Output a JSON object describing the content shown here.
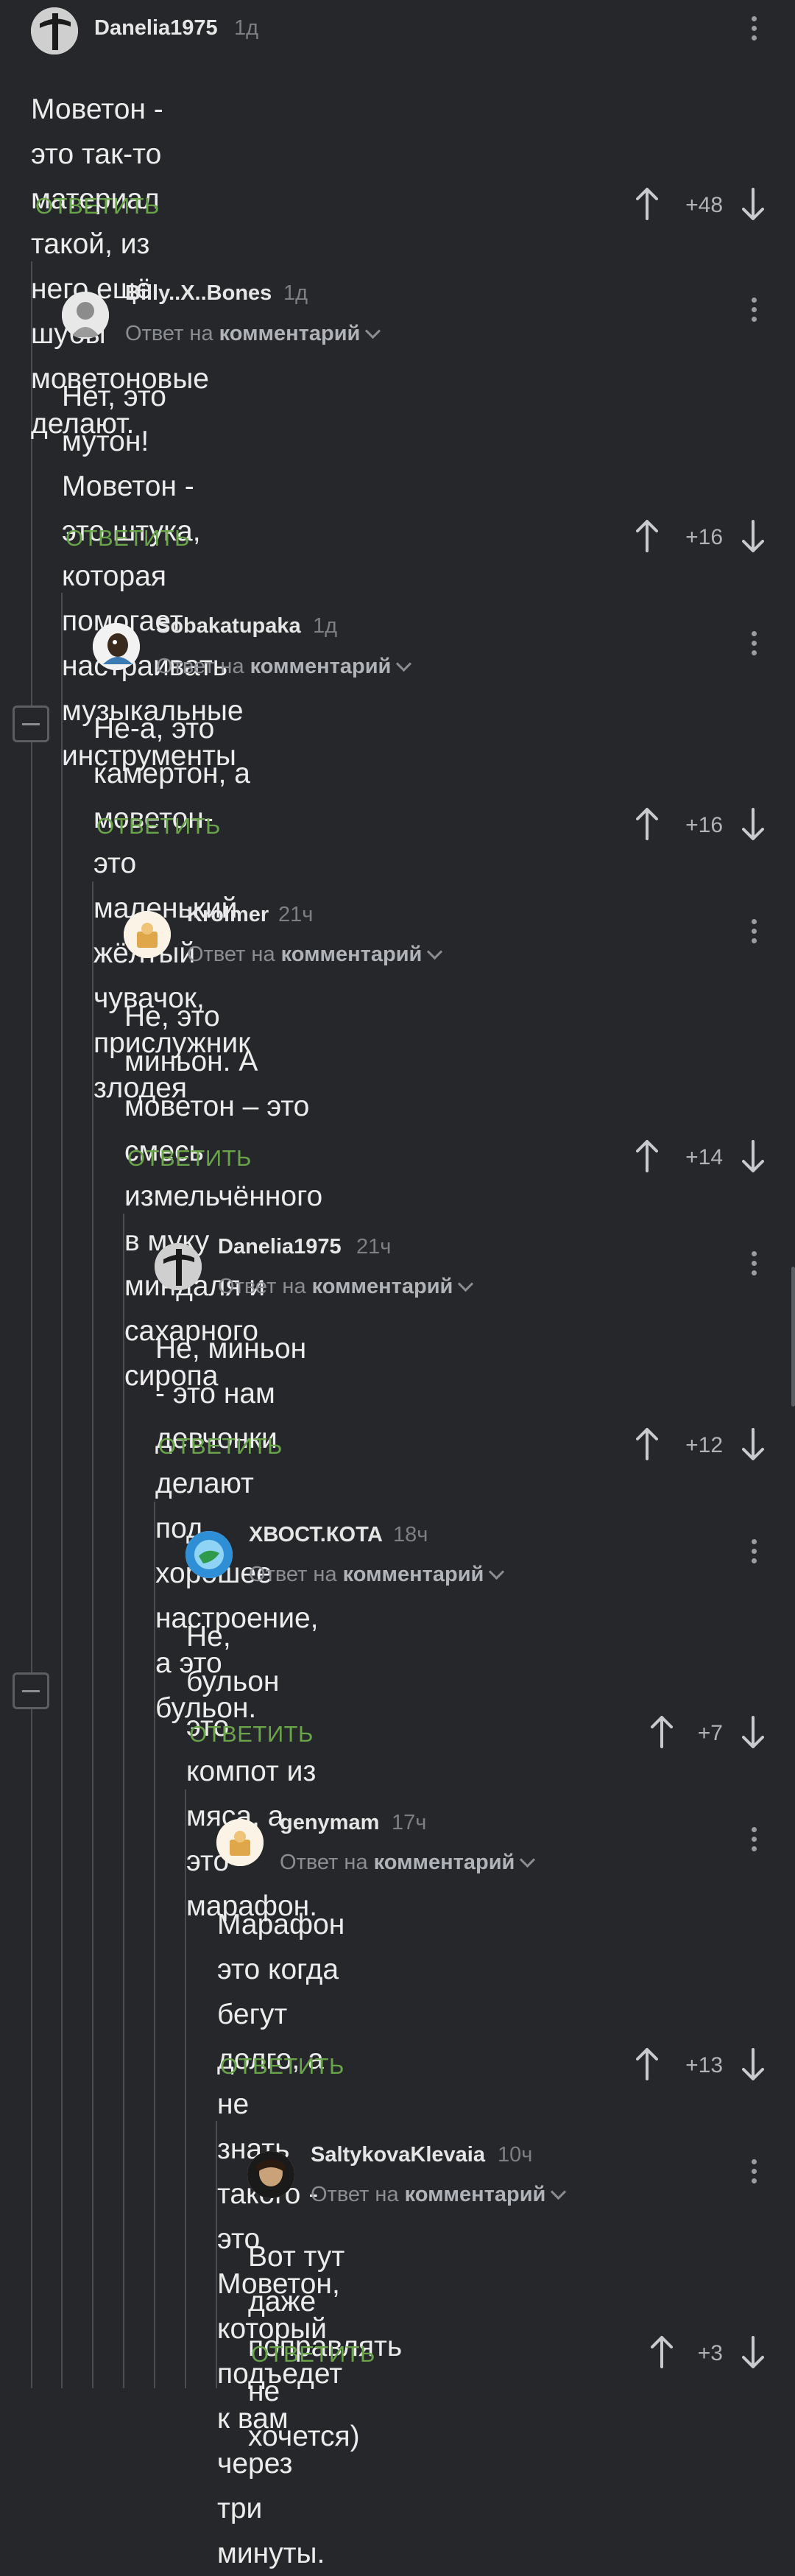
{
  "ui": {
    "reply_label": "ОТВЕТИТЬ",
    "reply_to_prefix": "Ответ на",
    "reply_to_link": "комментарий"
  },
  "comments": [
    {
      "user": "Danelia1975",
      "time": "1д",
      "reply_to": false,
      "lines": [
        "Моветон - это так-то материал такой, из него ещё",
        "шубы моветоновые делают."
      ],
      "rating": "+48"
    },
    {
      "user": "Billy..X..Bones",
      "time": "1д",
      "reply_to": true,
      "lines": [
        "Нет, это мутон! Моветон - это штука, которая",
        "помогает настраивать музыкальные",
        "инструменты"
      ],
      "rating": "+16"
    },
    {
      "user": "Sobakatupaka",
      "time": "1д",
      "reply_to": true,
      "lines": [
        "Не-а, это камертон, а моветон- это маленький",
        "жёлтый чувачок, прислужник злодея"
      ],
      "rating": "+16"
    },
    {
      "user": "Krolmer",
      "time": "21ч",
      "reply_to": true,
      "lines": [
        "Не, это миньон. А моветон – это смесь",
        "измельчённого в муку миндаля и",
        "сахарного сиропа"
      ],
      "rating": "+14"
    },
    {
      "user": "Danelia1975",
      "time": "21ч",
      "reply_to": true,
      "lines": [
        "Не, миньон - это нам девчонки делают",
        "под хорошее настроение, а это бульон."
      ],
      "rating": "+12"
    },
    {
      "user": "ХВОСТ.КОТА",
      "time": "18ч",
      "reply_to": true,
      "lines": [
        "Не, бульон это компот из мяса, а это",
        "марафон."
      ],
      "rating": "+7"
    },
    {
      "user": "genymam",
      "time": "17ч",
      "reply_to": true,
      "lines": [
        "Марафон это когда бегут долго, а не",
        "знать такого - это Моветон, который",
        "подъедет к вам через три минуты."
      ],
      "rating": "+13"
    },
    {
      "user": "SaltykovaKlevaia",
      "time": "10ч",
      "reply_to": true,
      "lines": [
        "Вот тут даже поправлять не",
        "хочется)"
      ],
      "rating": "+3"
    }
  ],
  "colors": {
    "background": "#25272a",
    "accent_green": "#6aa44a",
    "muted": "#8a8d92"
  }
}
